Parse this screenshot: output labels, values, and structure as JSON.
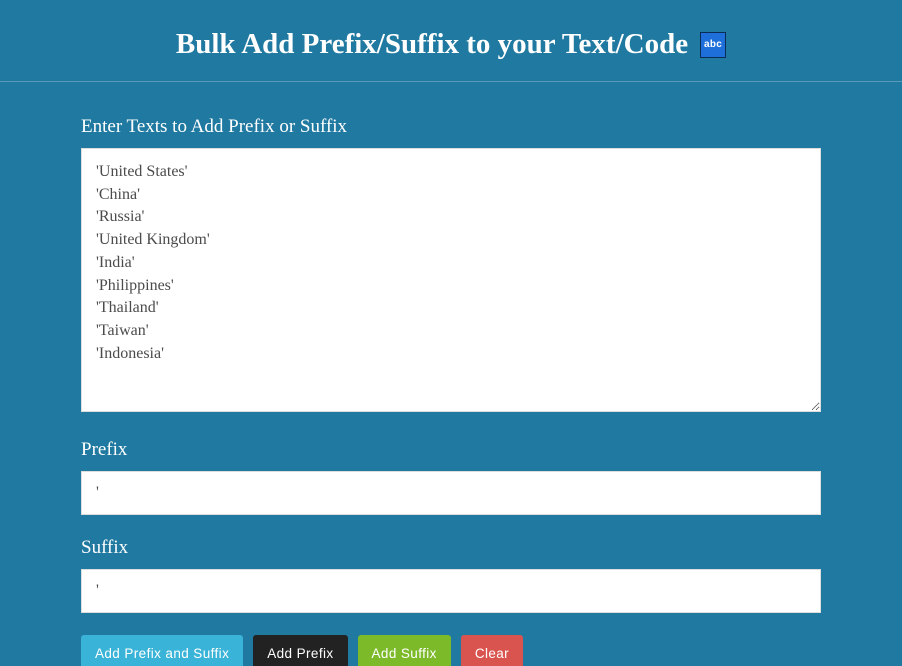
{
  "header": {
    "title": "Bulk Add Prefix/Suffix to your Text/Code",
    "badge": "abc"
  },
  "form": {
    "input_label": "Enter Texts to Add Prefix or Suffix",
    "input_value": "'United States'\n'China'\n'Russia'\n'United Kingdom'\n'India'\n'Philippines'\n'Thailand'\n'Taiwan'\n'Indonesia'",
    "prefix_label": "Prefix",
    "prefix_value": "'",
    "suffix_label": "Suffix",
    "suffix_value": "'"
  },
  "buttons": {
    "add_both": "Add Prefix and Suffix",
    "add_prefix": "Add Prefix",
    "add_suffix": "Add Suffix",
    "clear": "Clear"
  }
}
